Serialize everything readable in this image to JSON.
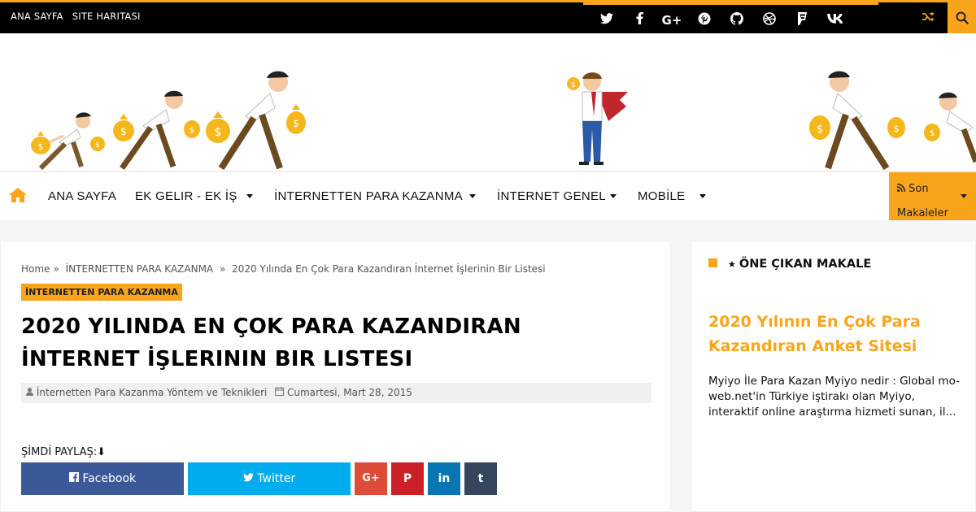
{
  "topbar": {
    "links": [
      "ANA SAYFA",
      "SITE HARITASI"
    ],
    "social_icons": [
      "twitter-icon",
      "facebook-icon",
      "google-plus-icon",
      "pinterest-icon",
      "github-icon",
      "dribbble-icon",
      "foursquare-icon",
      "vk-icon"
    ],
    "shuffle_icon": "shuffle-icon",
    "search_icon": "search-icon"
  },
  "nav": {
    "home_icon": "home-icon",
    "items": [
      {
        "label": "ANA SAYFA",
        "has_dropdown": false
      },
      {
        "label": "EK GELIR - EK İŞ",
        "has_dropdown": true
      },
      {
        "label": "İNTERNETTEN PARA KAZANMA",
        "has_dropdown": true
      },
      {
        "label": "İNTERNET GENEL",
        "has_dropdown": true
      },
      {
        "label": "MOBİLE",
        "has_dropdown": true
      }
    ],
    "recent": {
      "label": "Son Makaleler",
      "icon": "rss-icon"
    }
  },
  "article": {
    "breadcrumb": [
      "Home",
      "İNTERNETTEN PARA KAZANMA",
      "2020 Yılında En Çok Para Kazandıran İnternet İşlerinin Bir Listesi"
    ],
    "category": "İNTERNETTEN PARA KAZANMA",
    "title": "2020 YILINDA EN ÇOK PARA KAZANDIRAN İNTERNET İŞLERININ BIR LISTESI",
    "author": "İnternetten Para Kazanma Yöntem ve Teknikleri",
    "date": "Cumartesi, Mart 28, 2015",
    "share_label": "ŞİMDİ PAYLAŞ:⬇",
    "share": {
      "facebook": "Facebook",
      "twitter": "Twitter",
      "gplus": "G+",
      "pinterest": "P",
      "linkedin": "in",
      "tumblr": "t"
    }
  },
  "sidebar": {
    "heading": "⭑ ÖNE ÇIKAN MAKALE",
    "post_title": "2020 Yılının En Çok Para Kazandıran Anket Sitesi",
    "post_excerpt": "Myiyo İle Para Kazan Myiyo nedir : Global mo-web.net'in Türkiye iştirakı olan Myiyo, interaktif online araştırma hizmeti sunan, il..."
  },
  "colors": {
    "accent": "#f8a51c",
    "facebook": "#3b5998",
    "twitter": "#00acee",
    "gplus": "#dd4b39",
    "pinterest": "#cb2027",
    "linkedin": "#0976b4",
    "tumblr": "#35465c"
  }
}
